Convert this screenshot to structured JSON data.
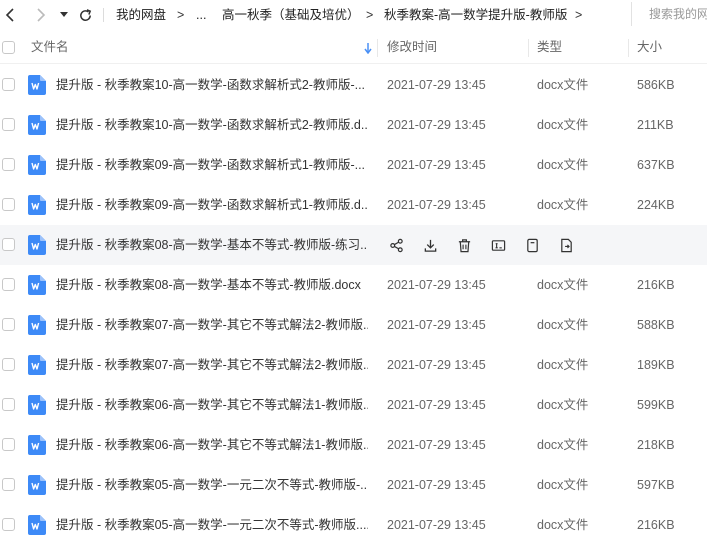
{
  "toolbar": {
    "back_icon": "chevron-left-icon",
    "forward_icon": "chevron-right-icon",
    "history_dropdown_icon": "caret-down-icon",
    "refresh_icon": "refresh-icon"
  },
  "breadcrumb": {
    "root": "我的网盘",
    "ellipsis": "...",
    "level2": "高一秋季（基础及培优）",
    "current": "秋季教案-高一数学提升版-教师版",
    "separator": ">"
  },
  "search": {
    "placeholder": "搜索我的网盘"
  },
  "columns": {
    "name": "文件名",
    "modified": "修改时间",
    "type": "类型",
    "size": "大小",
    "sort_icon": "arrow-down-icon"
  },
  "colors": {
    "accent": "#4a90f5",
    "doc_icon": "#3d8af7",
    "hover_row": "#f5f6f8"
  },
  "files": [
    {
      "name": "提升版 - 秋季教案10-高一数学-函数求解析式2-教师版-...",
      "modified": "2021-07-29 13:45",
      "type": "docx文件",
      "size": "586KB"
    },
    {
      "name": "提升版 - 秋季教案10-高一数学-函数求解析式2-教师版.d...",
      "modified": "2021-07-29 13:45",
      "type": "docx文件",
      "size": "211KB"
    },
    {
      "name": "提升版 - 秋季教案09-高一数学-函数求解析式1-教师版-...",
      "modified": "2021-07-29 13:45",
      "type": "docx文件",
      "size": "637KB"
    },
    {
      "name": "提升版 - 秋季教案09-高一数学-函数求解析式1-教师版.d...",
      "modified": "2021-07-29 13:45",
      "type": "docx文件",
      "size": "224KB"
    },
    {
      "name": "提升版 - 秋季教案08-高一数学-基本不等式-教师版-练习...",
      "hover": true,
      "actions": [
        "share-icon",
        "download-icon",
        "delete-icon",
        "rename-icon",
        "copy-icon",
        "move-icon"
      ]
    },
    {
      "name": "提升版 - 秋季教案08-高一数学-基本不等式-教师版.docx",
      "modified": "2021-07-29 13:45",
      "type": "docx文件",
      "size": "216KB"
    },
    {
      "name": "提升版 - 秋季教案07-高一数学-其它不等式解法2-教师版...",
      "modified": "2021-07-29 13:45",
      "type": "docx文件",
      "size": "588KB"
    },
    {
      "name": "提升版 - 秋季教案07-高一数学-其它不等式解法2-教师版....",
      "modified": "2021-07-29 13:45",
      "type": "docx文件",
      "size": "189KB"
    },
    {
      "name": "提升版 - 秋季教案06-高一数学-其它不等式解法1-教师版...",
      "modified": "2021-07-29 13:45",
      "type": "docx文件",
      "size": "599KB"
    },
    {
      "name": "提升版 - 秋季教案06-高一数学-其它不等式解法1-教师版....",
      "modified": "2021-07-29 13:45",
      "type": "docx文件",
      "size": "218KB"
    },
    {
      "name": "提升版 - 秋季教案05-高一数学-一元二次不等式-教师版-...",
      "modified": "2021-07-29 13:45",
      "type": "docx文件",
      "size": "597KB"
    },
    {
      "name": "提升版 - 秋季教案05-高一数学-一元二次不等式-教师版....",
      "modified": "2021-07-29 13:45",
      "type": "docx文件",
      "size": "216KB"
    }
  ]
}
